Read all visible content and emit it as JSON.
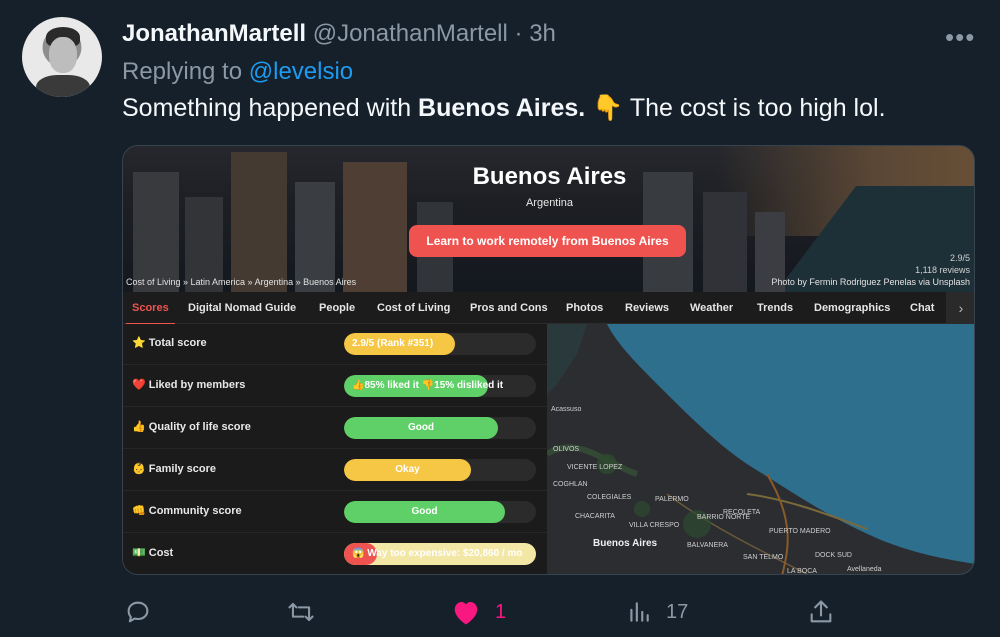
{
  "tweet": {
    "display_name": "JonathanMartell",
    "handle": "@JonathanMartell",
    "separator": "·",
    "time": "3h",
    "replying_prefix": "Replying to",
    "replying_handle": "@levelsio",
    "text_before": "Something happened with ",
    "text_bold": "Buenos Aires.",
    "text_emoji": "👇",
    "text_after": " The cost is too high lol.",
    "more_label": "•••"
  },
  "card": {
    "city": "Buenos Aires",
    "country": "Argentina",
    "cta_label": "Learn to work remotely from Buenos Aires",
    "breadcrumb": "Cost of Living » Latin America » Argentina » Buenos Aires",
    "rating_line1": "2.9/5",
    "rating_line2": "1,118 reviews",
    "photo_credit": "Photo by Fermin Rodriguez Penelas via Unsplash",
    "tabs": [
      "Scores",
      "Digital Nomad Guide",
      "People",
      "Cost of Living",
      "Pros and Cons",
      "Photos",
      "Reviews",
      "Weather",
      "Trends",
      "Demographics",
      "Chat"
    ],
    "tab_arrow": "›",
    "scores": [
      {
        "emoji": "⭐",
        "label": "Total score",
        "bar_text": "2.9/5 (Rank #351)",
        "level": 0.58,
        "color": "#f6c744"
      },
      {
        "emoji": "❤️",
        "label": "Liked by members",
        "bar_text": "👍85% liked it 👎15% disliked it",
        "level": 0.75,
        "color": "#5fd068"
      },
      {
        "emoji": "👍",
        "label": "Quality of life score",
        "bar_text": "Good",
        "level": 0.8,
        "color": "#5fd068"
      },
      {
        "emoji": "👶",
        "label": "Family score",
        "bar_text": "Okay",
        "level": 0.66,
        "color": "#f6c744"
      },
      {
        "emoji": "👊",
        "label": "Community score",
        "bar_text": "Good",
        "level": 0.84,
        "color": "#5fd068"
      },
      {
        "emoji": "💵",
        "label": "Cost",
        "bar_text": "😱 Way too expensive: $20,860 / mo",
        "level": 0.17,
        "color": "#ef5350"
      }
    ],
    "map_labels": [
      "Acassuso",
      "OLIVOS",
      "VICENTE LOPEZ",
      "COGHLAN",
      "COLEGIALES",
      "PALERMO",
      "CHACARITA",
      "VILLA CRESPO",
      "RECOLETA",
      "BARRIO NORTE",
      "BALVANERA",
      "Buenos Aires",
      "SAN TELMO",
      "LA BOCA",
      "Avellaneda",
      "DOCK SUD",
      "PUERTO MADERO"
    ]
  },
  "actions": {
    "reply_icon": "reply-icon",
    "retweet_icon": "retweet-icon",
    "like_icon": "heart-icon",
    "like_count": "1",
    "views_icon": "views-icon",
    "views_count": "17",
    "share_icon": "share-icon"
  },
  "colors": {
    "background": "#15202b",
    "link": "#1d9bf0",
    "like": "#f91880",
    "accent": "#ef5350"
  }
}
